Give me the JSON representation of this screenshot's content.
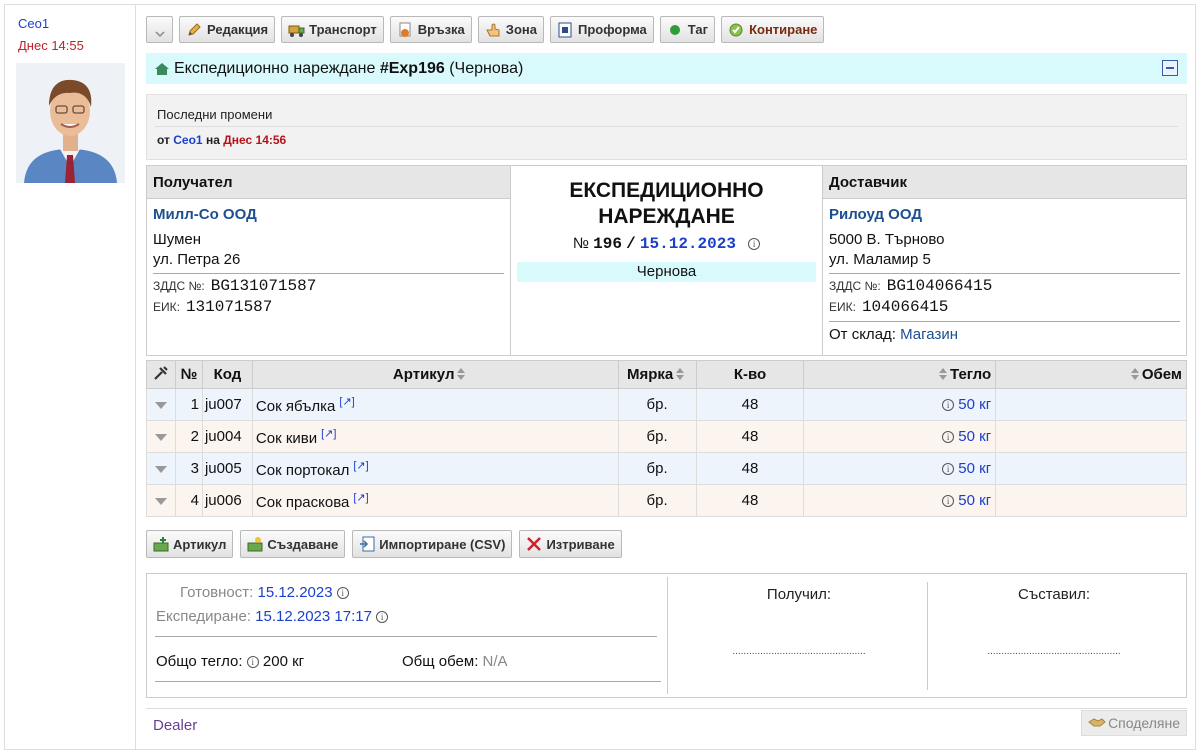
{
  "sidebar": {
    "author": "Ceo1",
    "date": "Днес 14:55"
  },
  "toolbar": {
    "dropdown_icon": "chevron-down-icon",
    "buttons": [
      {
        "label": "Редакция",
        "icon": "pencil-icon"
      },
      {
        "label": "Транспорт",
        "icon": "truck-icon"
      },
      {
        "label": "Връзка",
        "icon": "link-doc-icon"
      },
      {
        "label": "Зона",
        "icon": "hand-point-icon"
      },
      {
        "label": "Проформа",
        "icon": "proforma-icon"
      },
      {
        "label": "Таг",
        "icon": "green-dot-icon"
      },
      {
        "label": "Контиране",
        "icon": "check-circle-icon"
      }
    ]
  },
  "document": {
    "title_prefix": "Експедиционно нареждане",
    "handle": "#Exp196",
    "state": "(Чернова)"
  },
  "changes": {
    "heading": "Последни промени",
    "by_label": "от",
    "user": "Ceo1",
    "on_label": "на",
    "when": "Днес 14:56"
  },
  "recipient": {
    "header": "Получател",
    "name": "Милл-Со ООД",
    "city": "Шумен",
    "address": "ул. Петра 26",
    "vat_label": "ЗДДС №:",
    "vat": "BG131071587",
    "eik_label": "ЕИК:",
    "eik": "131071587"
  },
  "center": {
    "title_line1": "ЕКСПЕДИЦИОННО",
    "title_line2": "НАРЕЖДАНЕ",
    "number_label": "№",
    "number": "196",
    "slash": "/",
    "date": "15.12.2023",
    "status": "Чернова"
  },
  "supplier": {
    "header": "Доставчик",
    "name": "Рилоуд ООД",
    "city": "5000 В. Търново",
    "address": "ул. Маламир 5",
    "vat_label": "ЗДДС №:",
    "vat": "BG104066415",
    "eik_label": "ЕИК:",
    "eik": "104066415",
    "store_label": "От склад:",
    "store": "Магазин"
  },
  "items_table": {
    "headers": {
      "num": "№",
      "code": "Код",
      "article": "Артикул",
      "measure": "Мярка",
      "qty": "К-во",
      "weight": "Тегло",
      "volume": "Обем"
    },
    "rows": [
      {
        "num": "1",
        "code": "ju007",
        "article": "Сок ябълка",
        "measure": "бр.",
        "qty": "48",
        "weight": "50 кг",
        "volume": ""
      },
      {
        "num": "2",
        "code": "ju004",
        "article": "Сок киви",
        "measure": "бр.",
        "qty": "48",
        "weight": "50 кг",
        "volume": ""
      },
      {
        "num": "3",
        "code": "ju005",
        "article": "Сок портокал",
        "measure": "бр.",
        "qty": "48",
        "weight": "50 кг",
        "volume": ""
      },
      {
        "num": "4",
        "code": "ju006",
        "article": "Сок праскова",
        "measure": "бр.",
        "qty": "48",
        "weight": "50 кг",
        "volume": ""
      }
    ]
  },
  "actions": [
    {
      "label": "Артикул",
      "icon": "add-article-icon"
    },
    {
      "label": "Създаване",
      "icon": "create-icon"
    },
    {
      "label": "Импортиране (CSV)",
      "icon": "import-icon"
    },
    {
      "label": "Изтриване",
      "icon": "delete-icon"
    }
  ],
  "footer": {
    "ready_label": "Готовност:",
    "ready_date": "15.12.2023",
    "ship_label": "Експедиране:",
    "ship_date": "15.12.2023 17:17",
    "total_weight_label": "Общо тегло:",
    "total_weight": "200 кг",
    "total_volume_label": "Общ обем:",
    "total_volume": "N/A",
    "received_label": "Получил:",
    "compiled_label": "Съставил:",
    "signature_line": "................................................"
  },
  "bottom": {
    "dealer": "Dealer",
    "share": "Споделяне"
  }
}
